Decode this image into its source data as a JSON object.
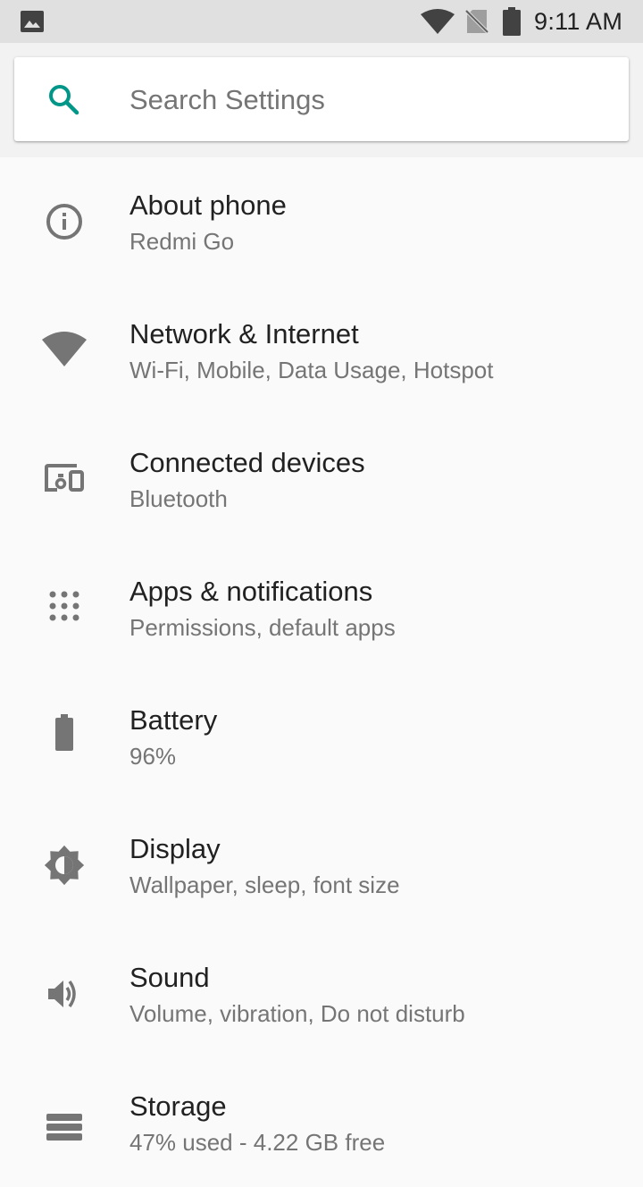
{
  "colors": {
    "accent": "#009688",
    "icon": "#757575",
    "text_primary": "#212121",
    "text_secondary": "#757575",
    "status_bar": "#e0e0e0",
    "background": "#fafafa"
  },
  "status_bar": {
    "time": "9:11 AM",
    "icons": [
      "gallery-icon",
      "wifi-icon",
      "no-sim-icon",
      "battery-icon"
    ]
  },
  "search": {
    "placeholder": "Search Settings",
    "icon": "search-icon"
  },
  "settings": [
    {
      "title": "About phone",
      "summary": "Redmi Go",
      "icon": "info-icon"
    },
    {
      "title": "Network & Internet",
      "summary": "Wi-Fi, Mobile, Data Usage, Hotspot",
      "icon": "wifi-icon"
    },
    {
      "title": "Connected devices",
      "summary": "Bluetooth",
      "icon": "devices-icon"
    },
    {
      "title": "Apps & notifications",
      "summary": "Permissions, default apps",
      "icon": "apps-grid-icon"
    },
    {
      "title": "Battery",
      "summary": "96%",
      "icon": "battery-icon"
    },
    {
      "title": "Display",
      "summary": "Wallpaper, sleep, font size",
      "icon": "brightness-icon"
    },
    {
      "title": "Sound",
      "summary": "Volume, vibration, Do not disturb",
      "icon": "volume-icon"
    },
    {
      "title": "Storage",
      "summary": "47% used - 4.22 GB free",
      "icon": "storage-icon"
    }
  ]
}
